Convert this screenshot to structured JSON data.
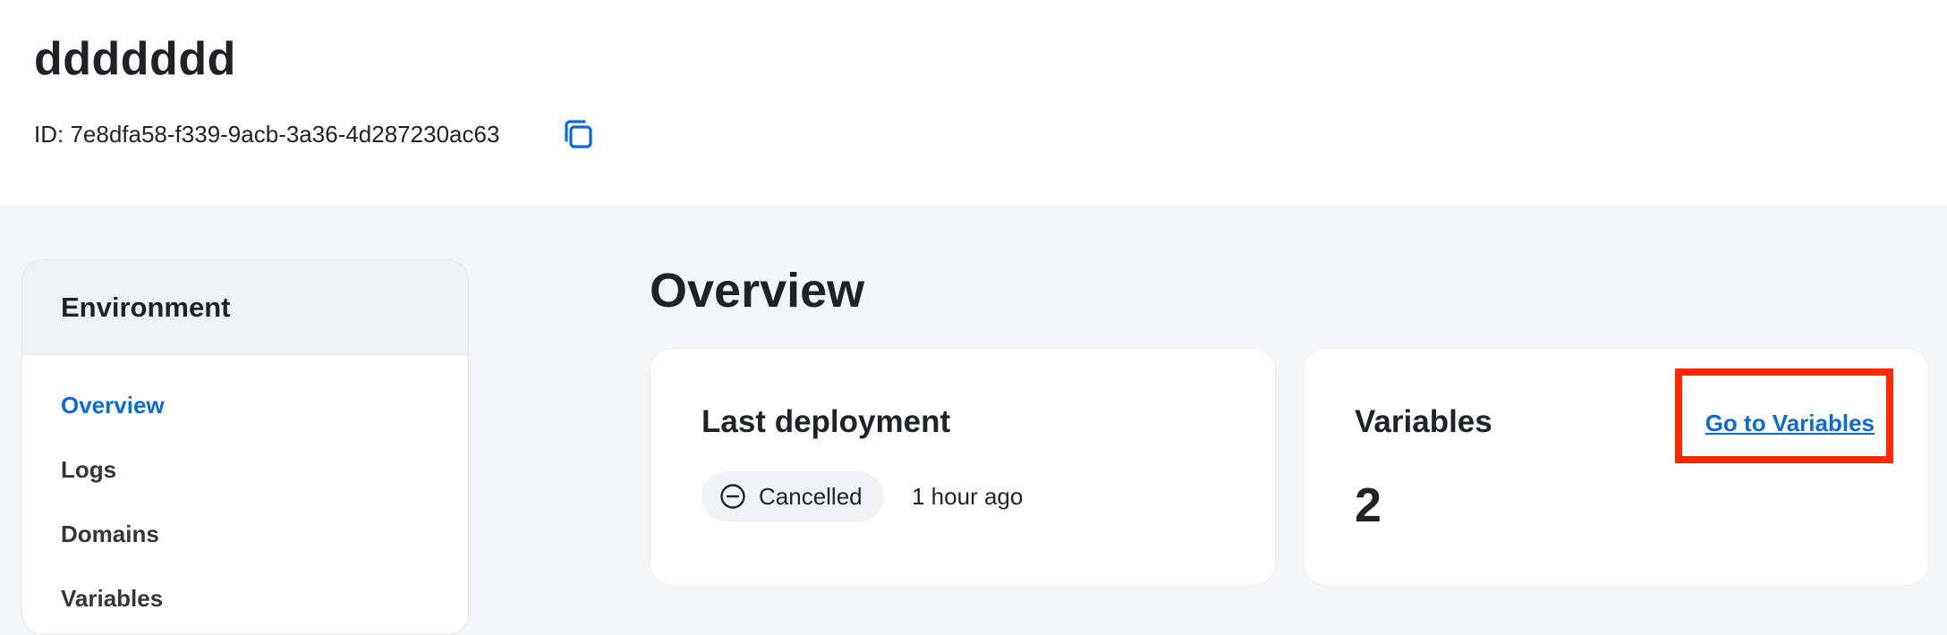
{
  "header": {
    "title": "ddddddd",
    "id_text": "ID: 7e8dfa58-f339-9acb-3a36-4d287230ac63",
    "copy_icon": "copy-icon"
  },
  "sidebar": {
    "heading": "Environment",
    "items": [
      {
        "label": "Overview",
        "active": true
      },
      {
        "label": "Logs",
        "active": false
      },
      {
        "label": "Domains",
        "active": false
      },
      {
        "label": "Variables",
        "active": false
      }
    ]
  },
  "main": {
    "title": "Overview",
    "deployment_card": {
      "title": "Last deployment",
      "status": "Cancelled",
      "status_icon": "cancel-circle-icon",
      "time": "1 hour ago"
    },
    "variables_card": {
      "title": "Variables",
      "link": "Go to Variables",
      "count": "2"
    }
  },
  "colors": {
    "accent": "#0a6ad8",
    "highlight": "#ff2a00",
    "background": "#f4f5f6"
  }
}
